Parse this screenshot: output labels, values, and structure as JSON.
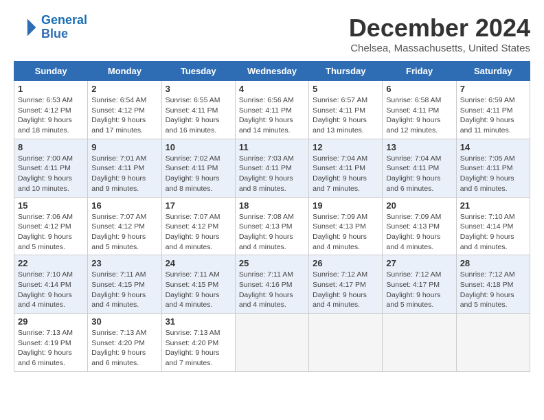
{
  "header": {
    "logo_line1": "General",
    "logo_line2": "Blue",
    "month": "December 2024",
    "location": "Chelsea, Massachusetts, United States"
  },
  "days_of_week": [
    "Sunday",
    "Monday",
    "Tuesday",
    "Wednesday",
    "Thursday",
    "Friday",
    "Saturday"
  ],
  "weeks": [
    [
      {
        "day": 1,
        "info": "Sunrise: 6:53 AM\nSunset: 4:12 PM\nDaylight: 9 hours\nand 18 minutes."
      },
      {
        "day": 2,
        "info": "Sunrise: 6:54 AM\nSunset: 4:12 PM\nDaylight: 9 hours\nand 17 minutes."
      },
      {
        "day": 3,
        "info": "Sunrise: 6:55 AM\nSunset: 4:11 PM\nDaylight: 9 hours\nand 16 minutes."
      },
      {
        "day": 4,
        "info": "Sunrise: 6:56 AM\nSunset: 4:11 PM\nDaylight: 9 hours\nand 14 minutes."
      },
      {
        "day": 5,
        "info": "Sunrise: 6:57 AM\nSunset: 4:11 PM\nDaylight: 9 hours\nand 13 minutes."
      },
      {
        "day": 6,
        "info": "Sunrise: 6:58 AM\nSunset: 4:11 PM\nDaylight: 9 hours\nand 12 minutes."
      },
      {
        "day": 7,
        "info": "Sunrise: 6:59 AM\nSunset: 4:11 PM\nDaylight: 9 hours\nand 11 minutes."
      }
    ],
    [
      {
        "day": 8,
        "info": "Sunrise: 7:00 AM\nSunset: 4:11 PM\nDaylight: 9 hours\nand 10 minutes."
      },
      {
        "day": 9,
        "info": "Sunrise: 7:01 AM\nSunset: 4:11 PM\nDaylight: 9 hours\nand 9 minutes."
      },
      {
        "day": 10,
        "info": "Sunrise: 7:02 AM\nSunset: 4:11 PM\nDaylight: 9 hours\nand 8 minutes."
      },
      {
        "day": 11,
        "info": "Sunrise: 7:03 AM\nSunset: 4:11 PM\nDaylight: 9 hours\nand 8 minutes."
      },
      {
        "day": 12,
        "info": "Sunrise: 7:04 AM\nSunset: 4:11 PM\nDaylight: 9 hours\nand 7 minutes."
      },
      {
        "day": 13,
        "info": "Sunrise: 7:04 AM\nSunset: 4:11 PM\nDaylight: 9 hours\nand 6 minutes."
      },
      {
        "day": 14,
        "info": "Sunrise: 7:05 AM\nSunset: 4:11 PM\nDaylight: 9 hours\nand 6 minutes."
      }
    ],
    [
      {
        "day": 15,
        "info": "Sunrise: 7:06 AM\nSunset: 4:12 PM\nDaylight: 9 hours\nand 5 minutes."
      },
      {
        "day": 16,
        "info": "Sunrise: 7:07 AM\nSunset: 4:12 PM\nDaylight: 9 hours\nand 5 minutes."
      },
      {
        "day": 17,
        "info": "Sunrise: 7:07 AM\nSunset: 4:12 PM\nDaylight: 9 hours\nand 4 minutes."
      },
      {
        "day": 18,
        "info": "Sunrise: 7:08 AM\nSunset: 4:13 PM\nDaylight: 9 hours\nand 4 minutes."
      },
      {
        "day": 19,
        "info": "Sunrise: 7:09 AM\nSunset: 4:13 PM\nDaylight: 9 hours\nand 4 minutes."
      },
      {
        "day": 20,
        "info": "Sunrise: 7:09 AM\nSunset: 4:13 PM\nDaylight: 9 hours\nand 4 minutes."
      },
      {
        "day": 21,
        "info": "Sunrise: 7:10 AM\nSunset: 4:14 PM\nDaylight: 9 hours\nand 4 minutes."
      }
    ],
    [
      {
        "day": 22,
        "info": "Sunrise: 7:10 AM\nSunset: 4:14 PM\nDaylight: 9 hours\nand 4 minutes."
      },
      {
        "day": 23,
        "info": "Sunrise: 7:11 AM\nSunset: 4:15 PM\nDaylight: 9 hours\nand 4 minutes."
      },
      {
        "day": 24,
        "info": "Sunrise: 7:11 AM\nSunset: 4:15 PM\nDaylight: 9 hours\nand 4 minutes."
      },
      {
        "day": 25,
        "info": "Sunrise: 7:11 AM\nSunset: 4:16 PM\nDaylight: 9 hours\nand 4 minutes."
      },
      {
        "day": 26,
        "info": "Sunrise: 7:12 AM\nSunset: 4:17 PM\nDaylight: 9 hours\nand 4 minutes."
      },
      {
        "day": 27,
        "info": "Sunrise: 7:12 AM\nSunset: 4:17 PM\nDaylight: 9 hours\nand 5 minutes."
      },
      {
        "day": 28,
        "info": "Sunrise: 7:12 AM\nSunset: 4:18 PM\nDaylight: 9 hours\nand 5 minutes."
      }
    ],
    [
      {
        "day": 29,
        "info": "Sunrise: 7:13 AM\nSunset: 4:19 PM\nDaylight: 9 hours\nand 6 minutes."
      },
      {
        "day": 30,
        "info": "Sunrise: 7:13 AM\nSunset: 4:20 PM\nDaylight: 9 hours\nand 6 minutes."
      },
      {
        "day": 31,
        "info": "Sunrise: 7:13 AM\nSunset: 4:20 PM\nDaylight: 9 hours\nand 7 minutes."
      },
      null,
      null,
      null,
      null
    ]
  ]
}
